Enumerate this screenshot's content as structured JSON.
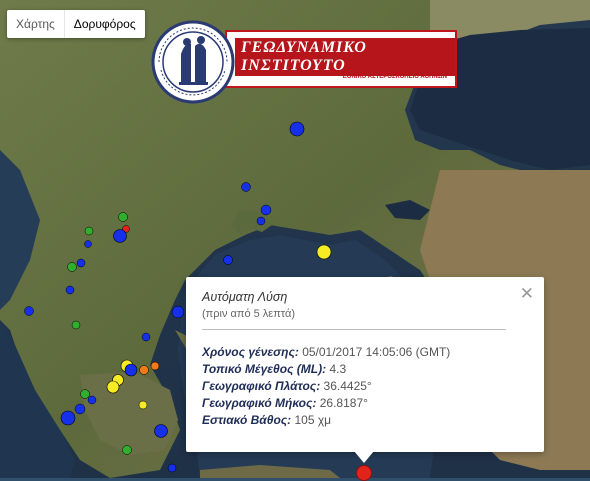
{
  "map_type": {
    "map_label": "Χάρτης",
    "satellite_label": "Δορυφόρος",
    "active": "satellite"
  },
  "logo": {
    "title": "ΓΕΩΔΥΝΑΜΙΚΟ ΙΝΣΤΙΤΟΥΤΟ",
    "subtitle": "ΕΘΝΙΚΟ ΑΣΤΕΡΟΣΚΟΠΕΙΟ ΑΘΗΝΩΝ"
  },
  "colors": {
    "magnitude_blue": "#1530e8",
    "magnitude_green": "#2fae2f",
    "magnitude_yellow": "#f5ec24",
    "magnitude_orange": "#f07a19",
    "quake_red": "#e2231a"
  },
  "popup": {
    "title": "Αυτόματη Λύση",
    "time_ago": "(πριν από 5 λεπτά)",
    "rows": [
      {
        "label": "Χρόνος γένεσης:",
        "value": "05/01/2017  14:05:06 (GMT)"
      },
      {
        "label": "Τοπικό Μέγεθος (ML):",
        "value": "4.3"
      },
      {
        "label": "Γεωγραφικό Πλάτος:",
        "value": "36.4425°"
      },
      {
        "label": "Γεωγραφικό Μήκος:",
        "value": "26.8187°"
      },
      {
        "label": "Εστιακό Βάθος:",
        "value": "105 χμ"
      }
    ]
  }
}
